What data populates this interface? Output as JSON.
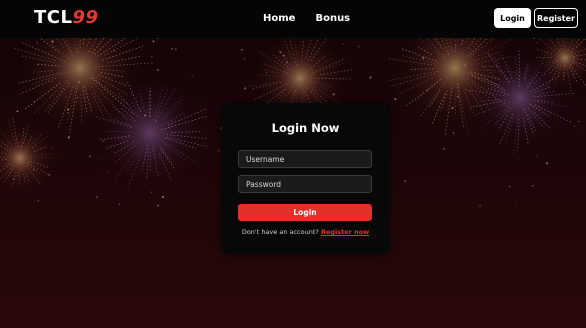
{
  "header": {
    "logo_main": "TCL",
    "logo_accent": "99",
    "nav": [
      {
        "label": "Home"
      },
      {
        "label": "Bonus"
      }
    ],
    "login_label": "Login",
    "register_label": "Register"
  },
  "login_card": {
    "title": "Login Now",
    "username_placeholder": "Username",
    "password_placeholder": "Password",
    "submit_label": "Login",
    "no_account_text": "Don't have an account?",
    "register_link": "Register now"
  },
  "colors": {
    "accent": "#e3302a",
    "header_bg": "#050505",
    "card_bg": "#080808",
    "background": "#1c0608"
  },
  "icons": [
    "fireworks-background"
  ]
}
